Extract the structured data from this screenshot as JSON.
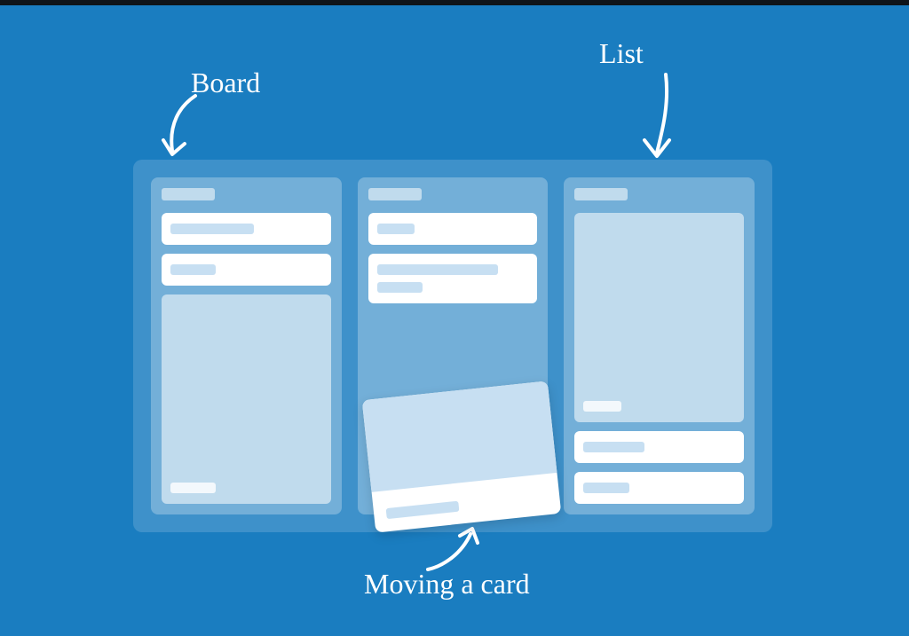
{
  "labels": {
    "board": "Board",
    "list": "List",
    "moving_card": "Moving a card"
  },
  "board": {
    "lists": [
      {
        "title": "",
        "cards": [
          {
            "type": "short",
            "lines": [
              "w55"
            ]
          },
          {
            "type": "short",
            "lines": [
              "w30"
            ]
          },
          {
            "type": "tall",
            "lines": [
              "w30"
            ]
          }
        ]
      },
      {
        "title": "",
        "cards": [
          {
            "type": "short",
            "lines": [
              "w25"
            ]
          },
          {
            "type": "multi",
            "lines": [
              "w80",
              "w30"
            ]
          }
        ]
      },
      {
        "title": "",
        "cards": [
          {
            "type": "tall",
            "lines": [
              "w25"
            ]
          },
          {
            "type": "short",
            "lines": [
              "w40"
            ]
          },
          {
            "type": "short",
            "lines": [
              "w30"
            ]
          }
        ]
      }
    ]
  }
}
